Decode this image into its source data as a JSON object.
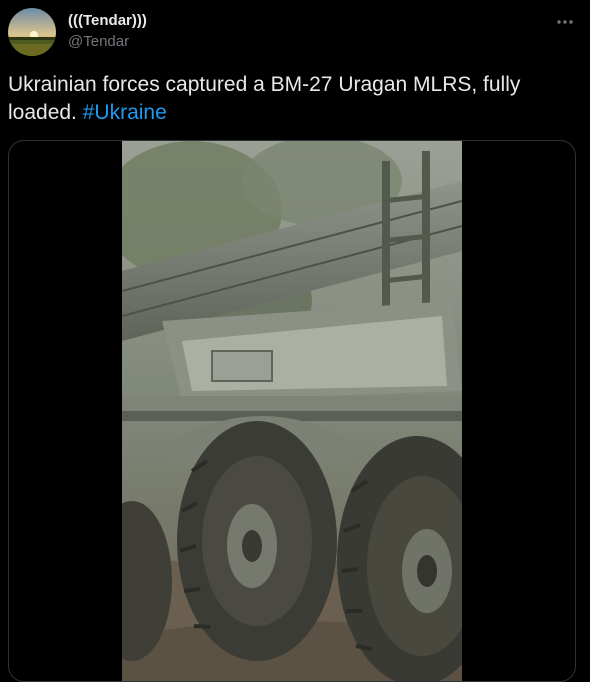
{
  "tweet": {
    "display_name": "(((Tendar)))",
    "handle": "@Tendar",
    "text": "Ukrainian forces captured a BM-27 Uragan MLRS, fully loaded.",
    "hashtag": "#Ukraine",
    "more_icon": "more-horizontal-icon"
  },
  "media": {
    "type": "video"
  },
  "colors": {
    "background": "#000000",
    "text": "#e7e9ea",
    "secondary_text": "#71767b",
    "link": "#1d9bf0",
    "border": "#2f3336"
  }
}
